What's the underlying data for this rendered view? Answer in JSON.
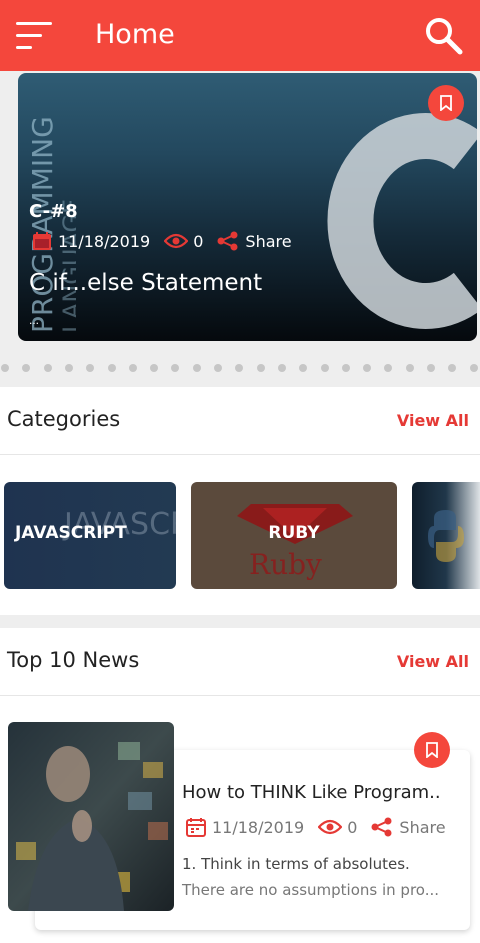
{
  "appbar": {
    "title": "Home",
    "menu_icon": "hamburger-menu-icon",
    "search_icon": "search-icon",
    "color": "#f4473c"
  },
  "hero": {
    "tag": "C-#8",
    "date": "11/18/2019",
    "views": "0",
    "share_label": "Share",
    "title": "C if...else Statement",
    "excerpt": "...",
    "image_text_vertical_1": "PROGRAMMING",
    "image_text_vertical_2": "LANGUAGE",
    "image_letter": "C",
    "bookmark_icon": "bookmark-icon"
  },
  "categories": {
    "title": "Categories",
    "view_all": "View All",
    "items": [
      {
        "label": "JAVASCRIPT",
        "bg_text": "JAVASCRIPT"
      },
      {
        "label": "RUBY",
        "bg_text": "Ruby"
      },
      {
        "label": ""
      }
    ]
  },
  "top_news": {
    "title": "Top 10 News",
    "view_all": "View All",
    "items": [
      {
        "title": "How to THINK Like Program..",
        "date": "11/18/2019",
        "views": "0",
        "share_label": "Share",
        "excerpt_line1": "1.  Think in terms of absolutes.",
        "excerpt_line2": "There are no assumptions in pro...",
        "bookmark_icon": "bookmark-icon"
      }
    ]
  },
  "colors": {
    "accent": "#f4473c",
    "view_all": "#e53935"
  }
}
